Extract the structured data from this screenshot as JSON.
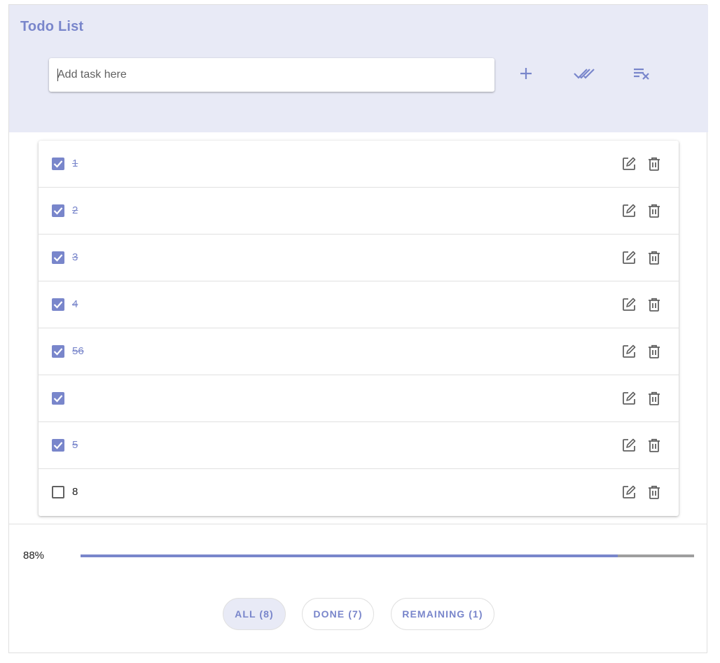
{
  "app": {
    "title": "Todo List",
    "accent_color": "#7986cb",
    "header_bg": "#e8eaf6"
  },
  "task_input": {
    "placeholder": "Add task here",
    "value": ""
  },
  "header_actions": [
    {
      "name": "add-task-button",
      "icon": "plus-icon"
    },
    {
      "name": "mark-all-done-button",
      "icon": "double-check-icon"
    },
    {
      "name": "clear-completed-button",
      "icon": "clear-list-icon"
    }
  ],
  "todos": [
    {
      "label": "1",
      "done": true
    },
    {
      "label": "2",
      "done": true
    },
    {
      "label": "3",
      "done": true
    },
    {
      "label": "4",
      "done": true
    },
    {
      "label": "56",
      "done": true
    },
    {
      "label": "",
      "done": true
    },
    {
      "label": "5",
      "done": true
    },
    {
      "label": "8",
      "done": false
    }
  ],
  "row_actions": {
    "edit_icon": "edit-icon",
    "delete_icon": "trash-icon"
  },
  "progress": {
    "label": "88%",
    "fraction": 0.875
  },
  "filters": [
    {
      "label": "ALL (8)",
      "active": true
    },
    {
      "label": "DONE (7)",
      "active": false
    },
    {
      "label": "REMAINING (1)",
      "active": false
    }
  ]
}
